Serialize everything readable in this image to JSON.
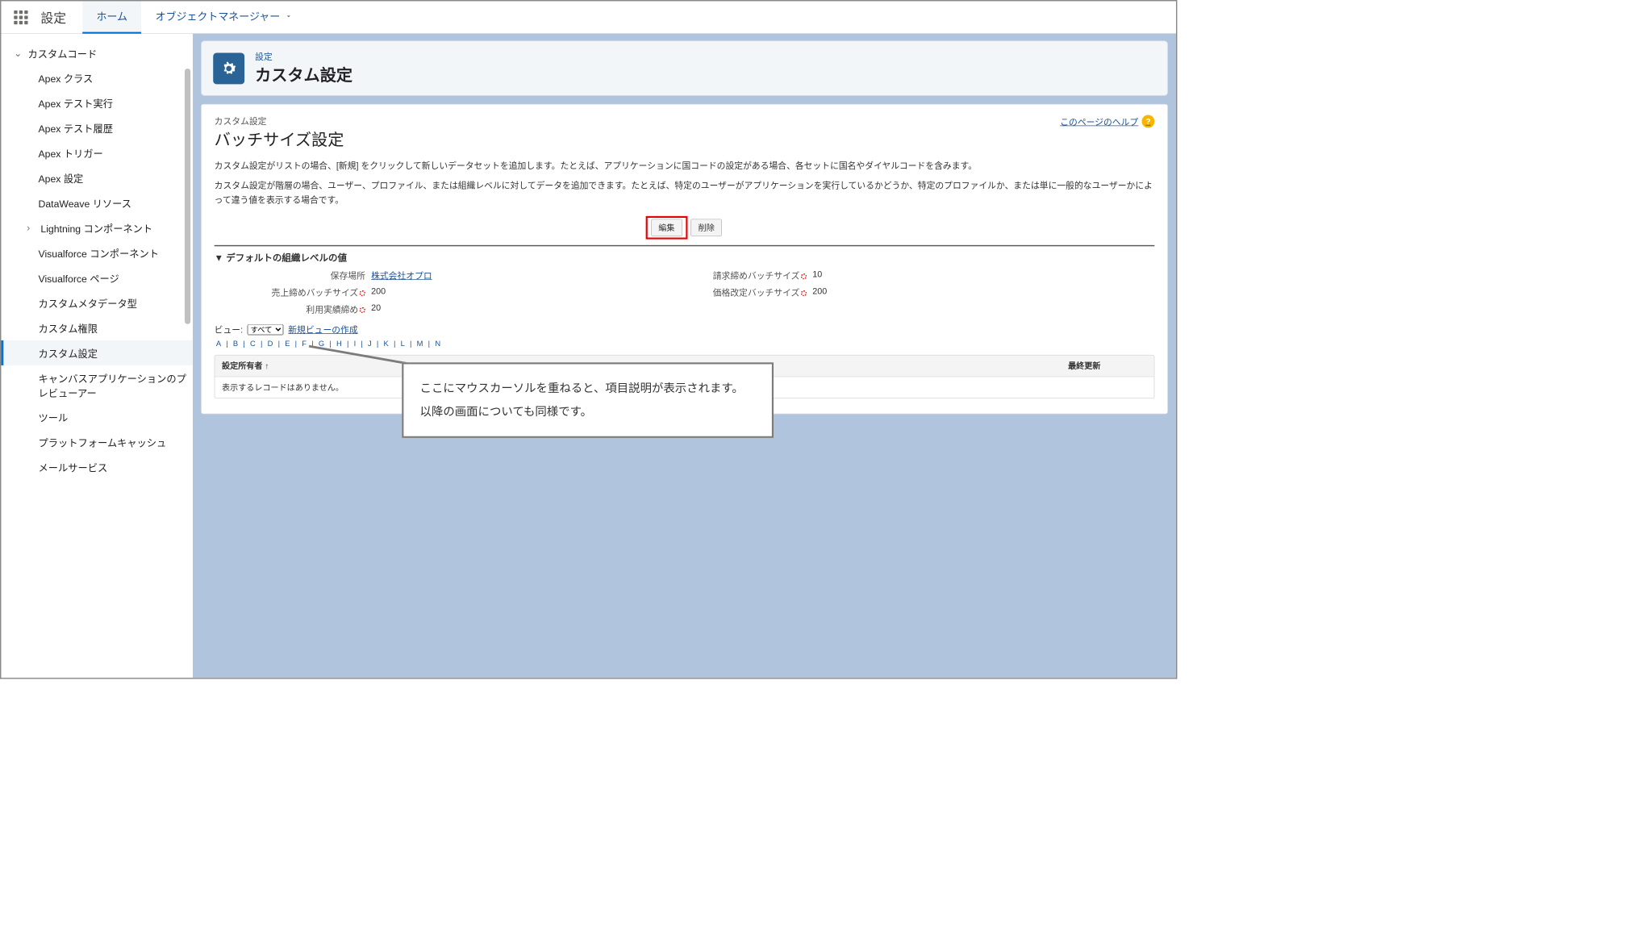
{
  "topnav": {
    "title": "設定",
    "tabs": {
      "home": "ホーム",
      "object_mgr": "オブジェクトマネージャー"
    }
  },
  "sidebar": {
    "section": "カスタムコード",
    "items": [
      "Apex クラス",
      "Apex テスト実行",
      "Apex テスト履歴",
      "Apex トリガー",
      "Apex 設定",
      "DataWeave リソース",
      "Lightning コンポーネント",
      "Visualforce コンポーネント",
      "Visualforce ページ",
      "カスタムメタデータ型",
      "カスタム権限",
      "カスタム設定",
      "キャンバスアプリケーションのプレビューアー",
      "ツール",
      "プラットフォームキャッシュ",
      "メールサービス"
    ],
    "expandable_index": 6,
    "selected_index": 11
  },
  "header": {
    "overline": "設定",
    "title": "カスタム設定"
  },
  "page": {
    "crumb": "カスタム設定",
    "title": "バッチサイズ設定",
    "help_link": "このページのヘルプ",
    "desc1": "カスタム設定がリストの場合、[新規] をクリックして新しいデータセットを追加します。たとえば、アプリケーションに国コードの設定がある場合、各セットに国名やダイヤルコードを含みます。",
    "desc2": "カスタム設定が階層の場合、ユーザー、プロファイル、または組織レベルに対してデータを追加できます。たとえば、特定のユーザーがアプリケーションを実行しているかどうか、特定のプロファイルか、または単に一般的なユーザーかによって違う値を表示する場合です。",
    "btn_edit": "編集",
    "btn_delete": "削除",
    "section_title": "デフォルトの組織レベルの値",
    "fields": {
      "storage_label": "保存場所",
      "storage_value": "株式会社オプロ",
      "sales_label": "売上締めバッチサイズ",
      "sales_value": "200",
      "usage_label": "利用実績締め",
      "usage_value": "20",
      "billing_label": "請求締めバッチサイズ",
      "billing_value": "10",
      "price_label": "価格改定バッチサイズ",
      "price_value": "200"
    },
    "view_label": "ビュー:",
    "view_option": "すべて",
    "new_view": "新規ビューの作成",
    "alpha": [
      "A",
      "B",
      "C",
      "D",
      "E",
      "F",
      "G",
      "H",
      "I",
      "J",
      "K",
      "L",
      "M",
      "N"
    ],
    "tbl_owner": "設定所有者 ↑",
    "tbl_col2": "最終更新",
    "tbl_empty": "表示するレコードはありません。"
  },
  "callout": {
    "line1": "ここにマウスカーソルを重ねると、項目説明が表示されます。",
    "line2": "以降の画面についても同様です。"
  }
}
